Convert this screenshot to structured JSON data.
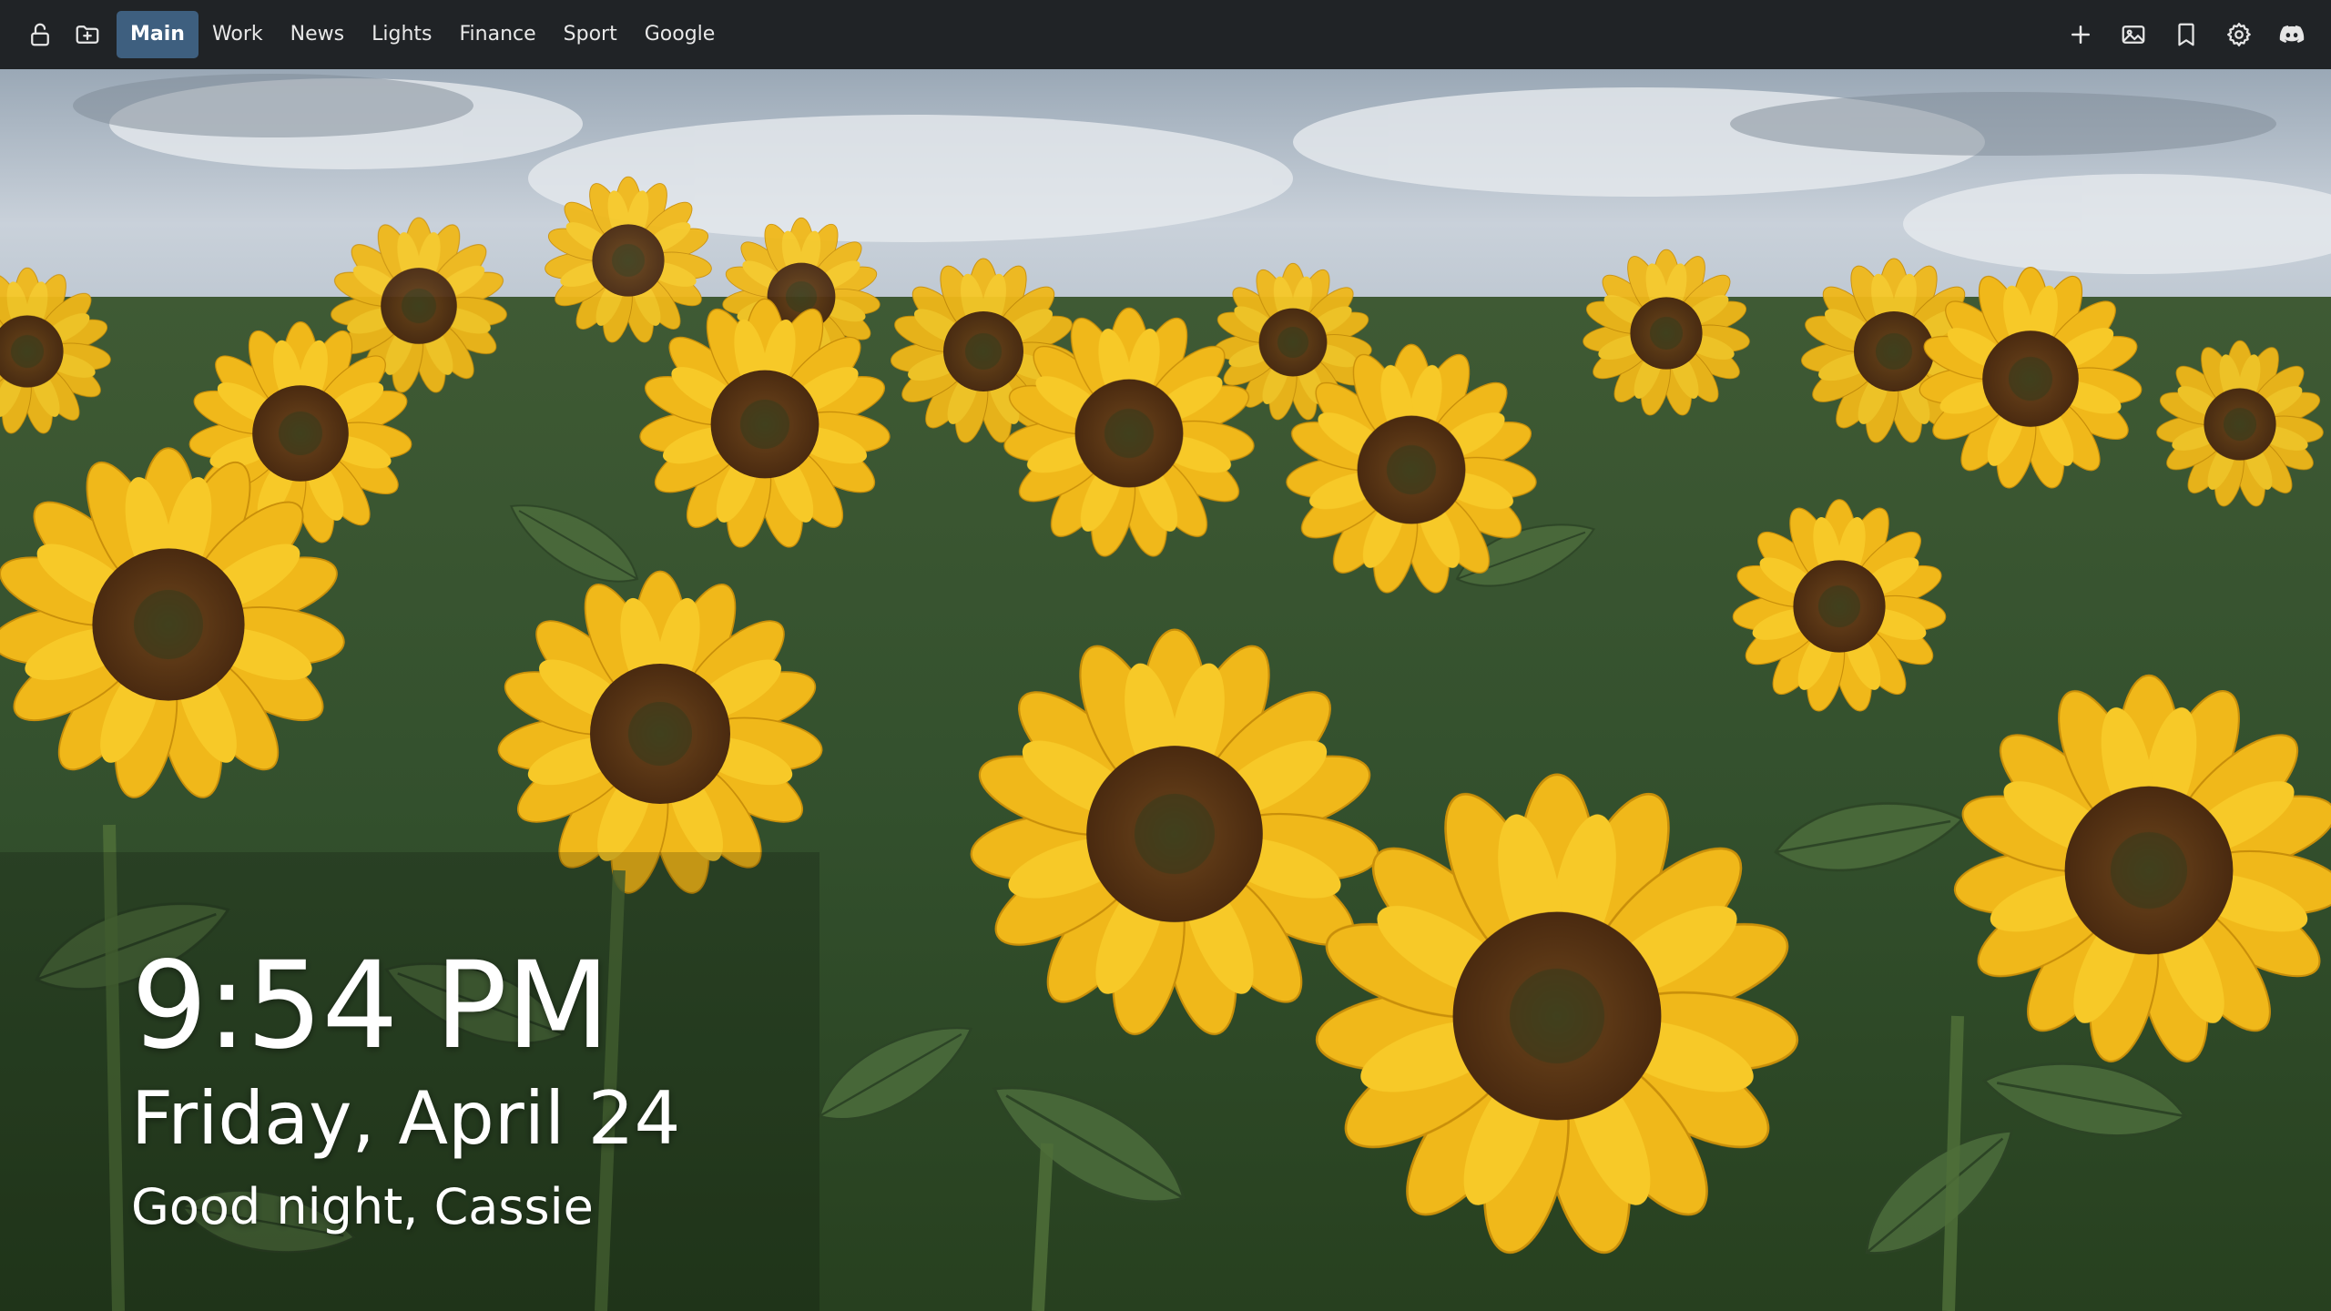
{
  "topbar": {
    "left_icons": [
      {
        "name": "lock-icon"
      },
      {
        "name": "folder-plus-icon"
      }
    ],
    "tabs": [
      {
        "label": "Main",
        "active": true
      },
      {
        "label": "Work",
        "active": false
      },
      {
        "label": "News",
        "active": false
      },
      {
        "label": "Lights",
        "active": false
      },
      {
        "label": "Finance",
        "active": false
      },
      {
        "label": "Sport",
        "active": false
      },
      {
        "label": "Google",
        "active": false
      }
    ],
    "right_icons": [
      {
        "name": "plus-icon"
      },
      {
        "name": "image-icon"
      },
      {
        "name": "bookmark-icon"
      },
      {
        "name": "gear-icon"
      },
      {
        "name": "discord-icon"
      }
    ]
  },
  "clock": {
    "time": "9:54 PM",
    "date": "Friday, April 24",
    "greeting": "Good night, Cassie"
  },
  "colors": {
    "topbar_bg": "#202326",
    "active_tab_bg": "#3e5f7f",
    "text": "#ffffff"
  }
}
